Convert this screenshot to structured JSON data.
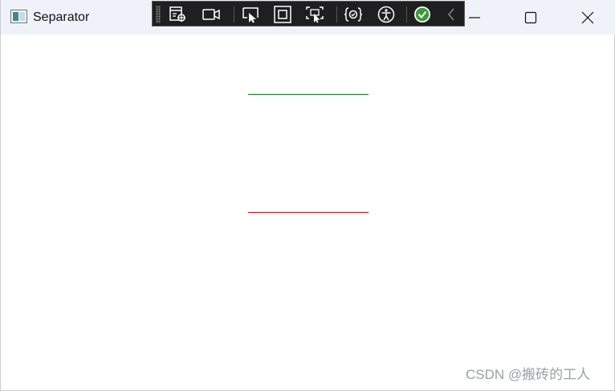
{
  "window": {
    "title": "Separator",
    "icon": "app-window-icon",
    "controls": {
      "minimize": "minimize-icon",
      "maximize": "maximize-icon",
      "close": "close-icon"
    }
  },
  "debug_toolbar": {
    "buttons": [
      {
        "name": "go-to-live-visual-tree-icon"
      },
      {
        "name": "show-in-app-toolbar-icon"
      },
      {
        "name": "select-element-icon"
      },
      {
        "name": "display-layout-adorners-icon"
      },
      {
        "name": "track-focused-element-icon"
      },
      {
        "name": "hot-reload-icon"
      },
      {
        "name": "accessibility-checker-icon"
      },
      {
        "name": "binding-status-ok-icon"
      },
      {
        "name": "collapse-toolbar-icon"
      }
    ]
  },
  "content": {
    "separators": [
      {
        "name": "separator-green",
        "color": "#0c7a0c"
      },
      {
        "name": "separator-red",
        "color": "#e00000"
      }
    ]
  },
  "watermark": "CSDN @搬砖的工人"
}
